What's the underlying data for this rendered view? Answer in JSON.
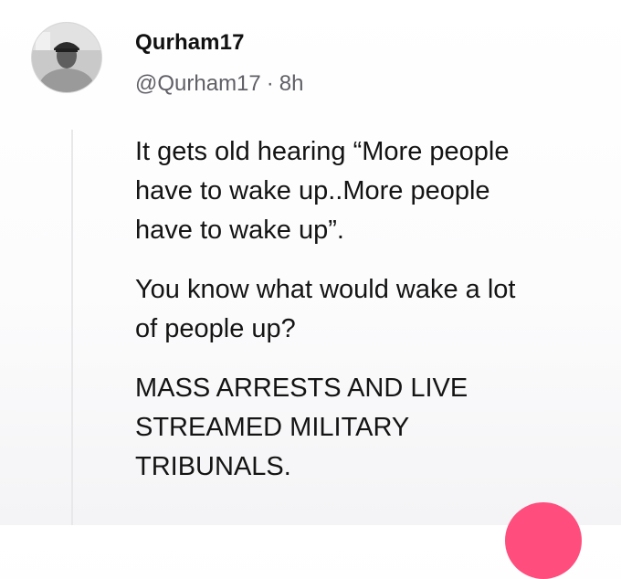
{
  "post": {
    "author": {
      "display_name": "Qurham17",
      "handle": "@Qurham17",
      "time_ago": "8h",
      "avatar_icon": "profile-photo"
    },
    "separator": "·",
    "paragraphs": [
      [
        "It gets old hearing “More people",
        "have to wake up..More people",
        "have to wake up”."
      ],
      [
        "You know what would wake a lot",
        "of people up?"
      ],
      [
        "MASS ARRESTS AND LIVE",
        "STREAMED MILITARY",
        "TRIBUNALS."
      ]
    ]
  },
  "colors": {
    "accent": "#ff4d7d",
    "thread_line": "#e8e8ea",
    "meta_text": "#5f5f66"
  }
}
